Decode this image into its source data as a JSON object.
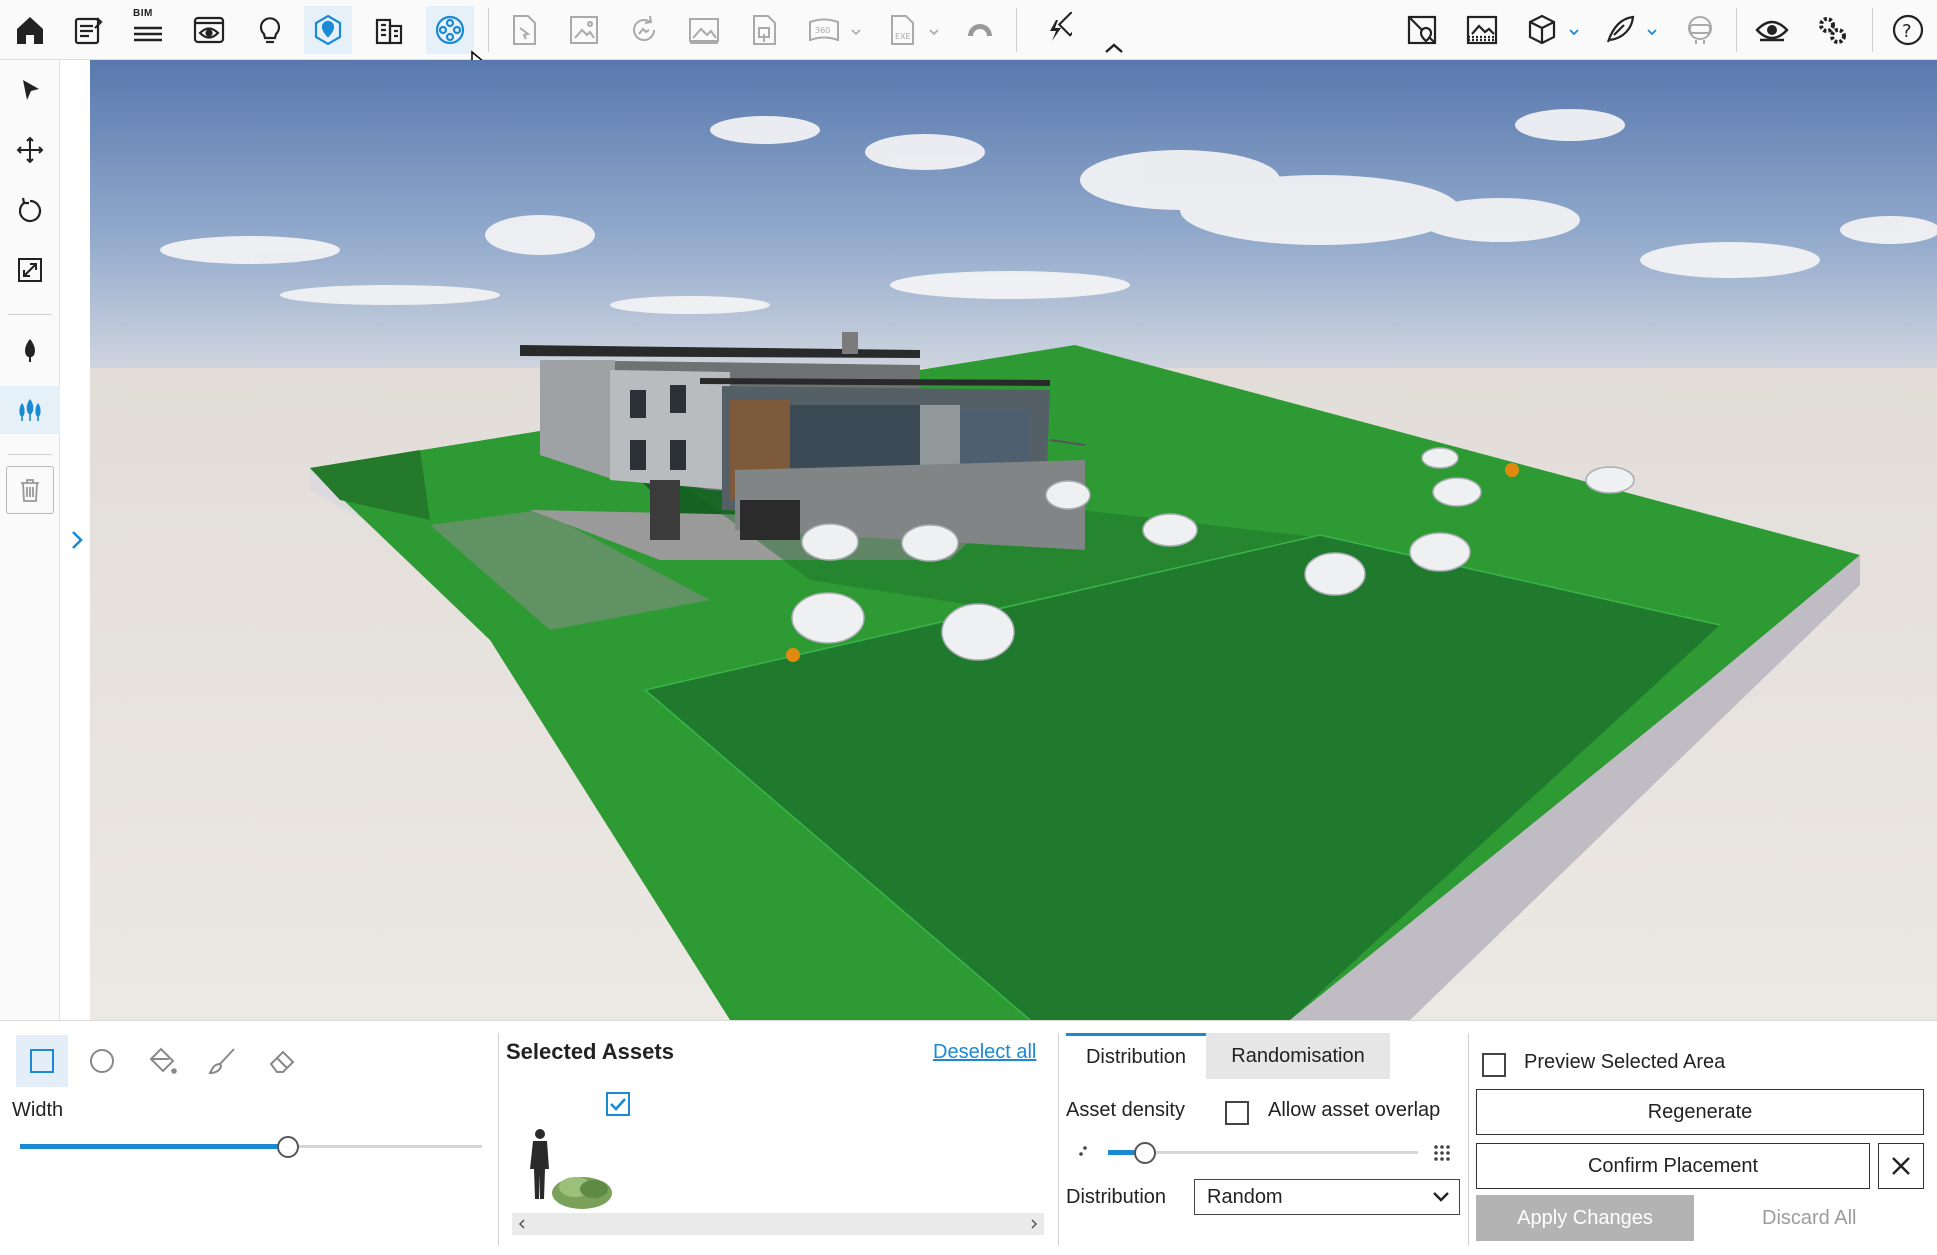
{
  "top_toolbar": {
    "bim_label": "BIM",
    "icons": [
      "home-icon",
      "notes-icon",
      "bim-icon",
      "eye-frame-icon",
      "lightbulb-icon",
      "map-pin-icon",
      "building-icon",
      "film-reel-icon",
      "export-file-icon",
      "image-export-icon",
      "image-refresh-icon",
      "picture-icon",
      "document-export-icon",
      "panorama-360-icon",
      "exe-export-icon",
      "cloud-icon",
      "lightning-icon",
      "map-pin-x-icon",
      "image-grid-icon",
      "cube-icon",
      "feather-icon",
      "vr-headset-icon",
      "eye-icon",
      "settings-icon",
      "help-icon"
    ]
  },
  "left_toolbar": {
    "tools": [
      "select-arrow-icon",
      "move-icon",
      "rotate-icon",
      "scale-icon",
      "tree-single-icon",
      "trees-scatter-icon",
      "trash-icon"
    ],
    "active_tool": "trees-scatter-icon"
  },
  "bottom_panel": {
    "shape_tools": {
      "icons": [
        "rectangle-select-icon",
        "circle-select-icon",
        "paint-bucket-icon",
        "brush-icon",
        "eraser-icon"
      ],
      "active": "rectangle-select-icon",
      "width_label": "Width",
      "width_value": 0.58
    },
    "selected_assets": {
      "title": "Selected Assets",
      "deselect_label": "Deselect all",
      "asset_checked": true
    },
    "distribution": {
      "tabs": [
        "Distribution",
        "Randomisation"
      ],
      "active_tab": "Distribution",
      "density_label": "Asset density",
      "overlap_label": "Allow asset overlap",
      "overlap_checked": false,
      "density_value": 0.12,
      "distribution_label": "Distribution",
      "distribution_value": "Random"
    },
    "actions": {
      "preview_label": "Preview Selected Area",
      "preview_checked": false,
      "regenerate_label": "Regenerate",
      "confirm_label": "Confirm Placement",
      "apply_label": "Apply Changes",
      "discard_label": "Discard All"
    }
  },
  "colors": {
    "accent": "#1a8ad4",
    "toolbar_bg": "#fafafa",
    "lawn": "#2e9a33",
    "selected_area": "#1f7a2e",
    "marker": "#e08a10",
    "apply_btn_bg": "#b3b3b3"
  }
}
